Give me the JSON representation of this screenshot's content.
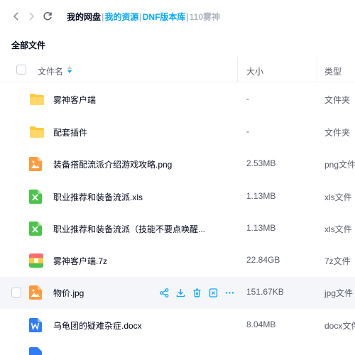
{
  "breadcrumb": {
    "items": [
      {
        "label": "我的网盘"
      },
      {
        "label": "我的资源"
      },
      {
        "label": "DNF版本库"
      },
      {
        "label": "110雾神"
      }
    ],
    "separator": "|"
  },
  "section_title": "全部文件",
  "table": {
    "columns": {
      "name": "文件名",
      "size": "大小",
      "type": "类型"
    },
    "rows": [
      {
        "name": "雾神客户端",
        "size": "-",
        "type": "文件夹",
        "icon": "folder-icon"
      },
      {
        "name": "配套插件",
        "size": "-",
        "type": "文件夹",
        "icon": "folder-icon"
      },
      {
        "name": "装备搭配流派介绍游戏攻略.png",
        "size": "2.53MB",
        "type": "png文件",
        "icon": "image-file-icon"
      },
      {
        "name": "职业推荐和装备流派.xls",
        "size": "1.13MB",
        "type": "xls文件",
        "icon": "excel-file-icon"
      },
      {
        "name": "职业推荐和装备流派（技能不要点唤醒...",
        "size": "1.13MB",
        "type": "xls文件",
        "icon": "excel-file-icon"
      },
      {
        "name": "雾神客户端.7z",
        "size": "22.84GB",
        "type": "7z文件",
        "icon": "archive-file-icon"
      },
      {
        "name": "物价.jpg",
        "size": "151.67KB",
        "type": "jpg文件",
        "icon": "image-file-icon"
      },
      {
        "name": "乌龟团的疑难杂症.docx",
        "size": "8.04MB",
        "type": "docx文件",
        "icon": "word-file-icon"
      }
    ]
  },
  "colors": {
    "accent": "#06a7ff",
    "folder": "#ffc83d",
    "image": "#ff9a3d",
    "excel": "#4cc34a",
    "word": "#2f7cf6"
  }
}
